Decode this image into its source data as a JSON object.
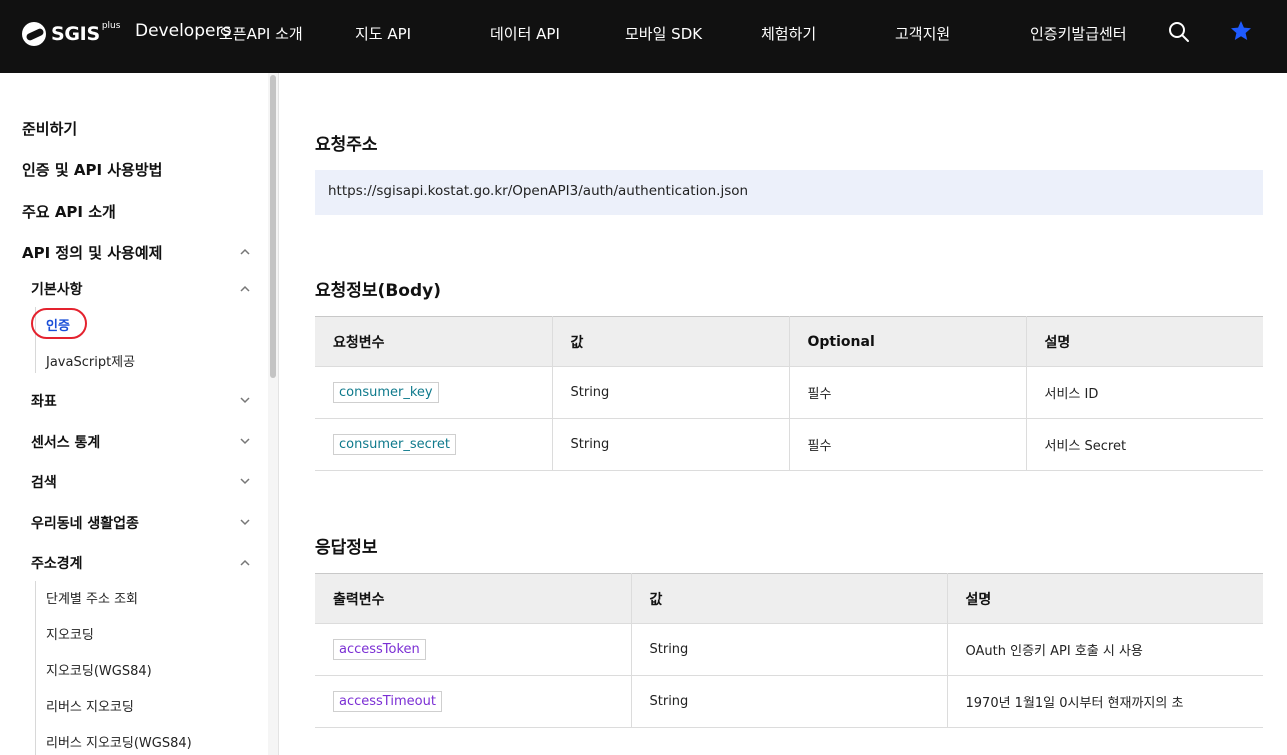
{
  "header": {
    "logo_text": "SGIS",
    "logo_sup": "plus",
    "brand": "Developers",
    "nav": [
      "오픈API 소개",
      "지도 API",
      "데이터 API",
      "모바일 SDK",
      "체험하기",
      "고객지원",
      "인증키발급센터"
    ],
    "icons": [
      "search-icon",
      "star-icon"
    ],
    "accent_color": "#1f5bff"
  },
  "sidebar": {
    "sections": [
      "준비하기",
      "인증 및 API 사용방법",
      "주요 API 소개",
      "API 정의 및 사용예제"
    ],
    "sub_basic": "기본사항",
    "basic_items": [
      "인증",
      "JavaScript제공"
    ],
    "sub_items": [
      "좌표",
      "센서스 통계",
      "검색",
      "우리동네 생활업종",
      "주소경계"
    ],
    "address_items": [
      "단계별 주소 조회",
      "지오코딩",
      "지오코딩(WGS84)",
      "리버스 지오코딩",
      "리버스 지오코딩(WGS84)"
    ],
    "active_item": "인증"
  },
  "main": {
    "request_url_title": "요청주소",
    "request_url": "https://sgisapi.kostat.go.kr/OpenAPI3/auth/authentication.json",
    "request_body_title": "요청정보(Body)",
    "request_table": {
      "headers": [
        "요청변수",
        "값",
        "Optional",
        "설명"
      ],
      "rows": [
        [
          "consumer_key",
          "String",
          "필수",
          "서비스 ID"
        ],
        [
          "consumer_secret",
          "String",
          "필수",
          "서비스 Secret"
        ]
      ]
    },
    "response_title": "응답정보",
    "response_table": {
      "headers": [
        "출력변수",
        "값",
        "설명"
      ],
      "rows": [
        [
          "accessToken",
          "String",
          "OAuth 인증키 API 호출 시 사용"
        ],
        [
          "accessTimeout",
          "String",
          "1970년 1월1일 0시부터 현재까지의 초"
        ]
      ]
    }
  }
}
